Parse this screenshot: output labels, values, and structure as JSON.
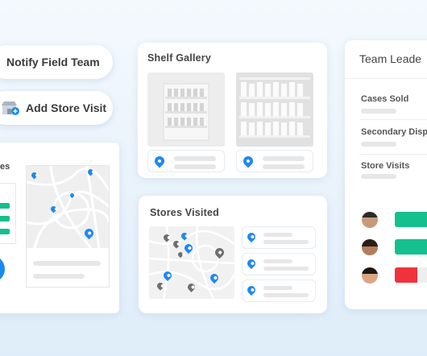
{
  "actions": {
    "notify_label": "Notify Field Team",
    "add_visit_label": "Add Store Visit"
  },
  "left_panel": {
    "title_fragment": "es"
  },
  "shelf_gallery": {
    "title": "Shelf Gallery"
  },
  "stores_visited": {
    "title": "Stores Visited"
  },
  "team_leaderboard": {
    "title": "Team Leade",
    "metrics": [
      {
        "label": "Cases Sold"
      },
      {
        "label": "Secondary Displ"
      },
      {
        "label": "Store Visits"
      }
    ],
    "members": [
      {
        "status_color": "#14c08e"
      },
      {
        "status_color": "#14c08e"
      },
      {
        "status_color": "#f0323c"
      }
    ]
  },
  "colors": {
    "accent_blue": "#1e88f5",
    "success_green": "#14c08e",
    "alert_red": "#f0323c"
  }
}
